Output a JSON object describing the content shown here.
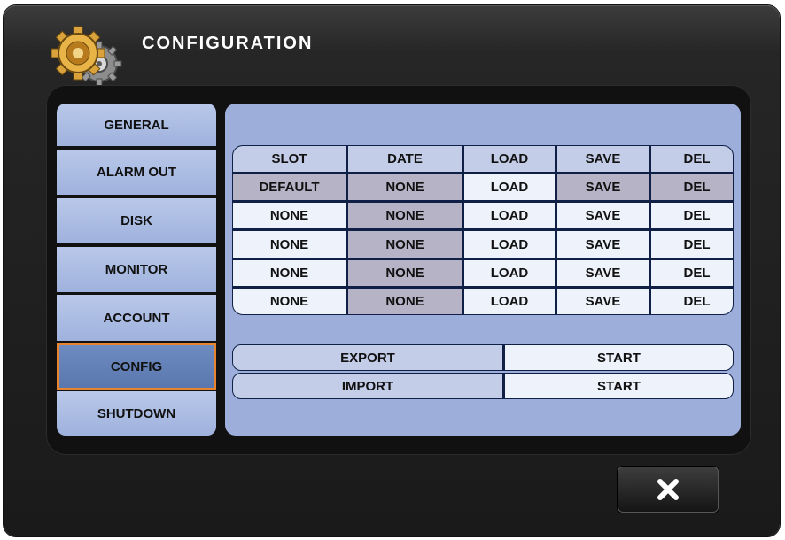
{
  "window": {
    "title": "CONFIGURATION"
  },
  "sidebar": {
    "items": [
      {
        "label": "GENERAL"
      },
      {
        "label": "ALARM OUT"
      },
      {
        "label": "DISK"
      },
      {
        "label": "MONITOR"
      },
      {
        "label": "ACCOUNT"
      },
      {
        "label": "CONFIG",
        "active": true
      },
      {
        "label": "SHUTDOWN"
      }
    ]
  },
  "config_table": {
    "headers": [
      "SLOT",
      "DATE",
      "LOAD",
      "SAVE",
      "DEL"
    ],
    "rows": [
      [
        "DEFAULT",
        "NONE",
        "LOAD",
        "SAVE",
        "DEL"
      ],
      [
        "NONE",
        "NONE",
        "LOAD",
        "SAVE",
        "DEL"
      ],
      [
        "NONE",
        "NONE",
        "LOAD",
        "SAVE",
        "DEL"
      ],
      [
        "NONE",
        "NONE",
        "LOAD",
        "SAVE",
        "DEL"
      ],
      [
        "NONE",
        "NONE",
        "LOAD",
        "SAVE",
        "DEL"
      ]
    ]
  },
  "transfer": {
    "export_label": "EXPORT",
    "export_action": "START",
    "import_label": "IMPORT",
    "import_action": "START"
  },
  "colors": {
    "accent_border": "#e8832f",
    "panel_bg": "#9daedb",
    "tab_bg": "#b9c8ea",
    "tab_active_bg": "#6e8bc0"
  },
  "icons": {
    "title_icon": "gears-icon",
    "close_icon": "close-icon"
  }
}
